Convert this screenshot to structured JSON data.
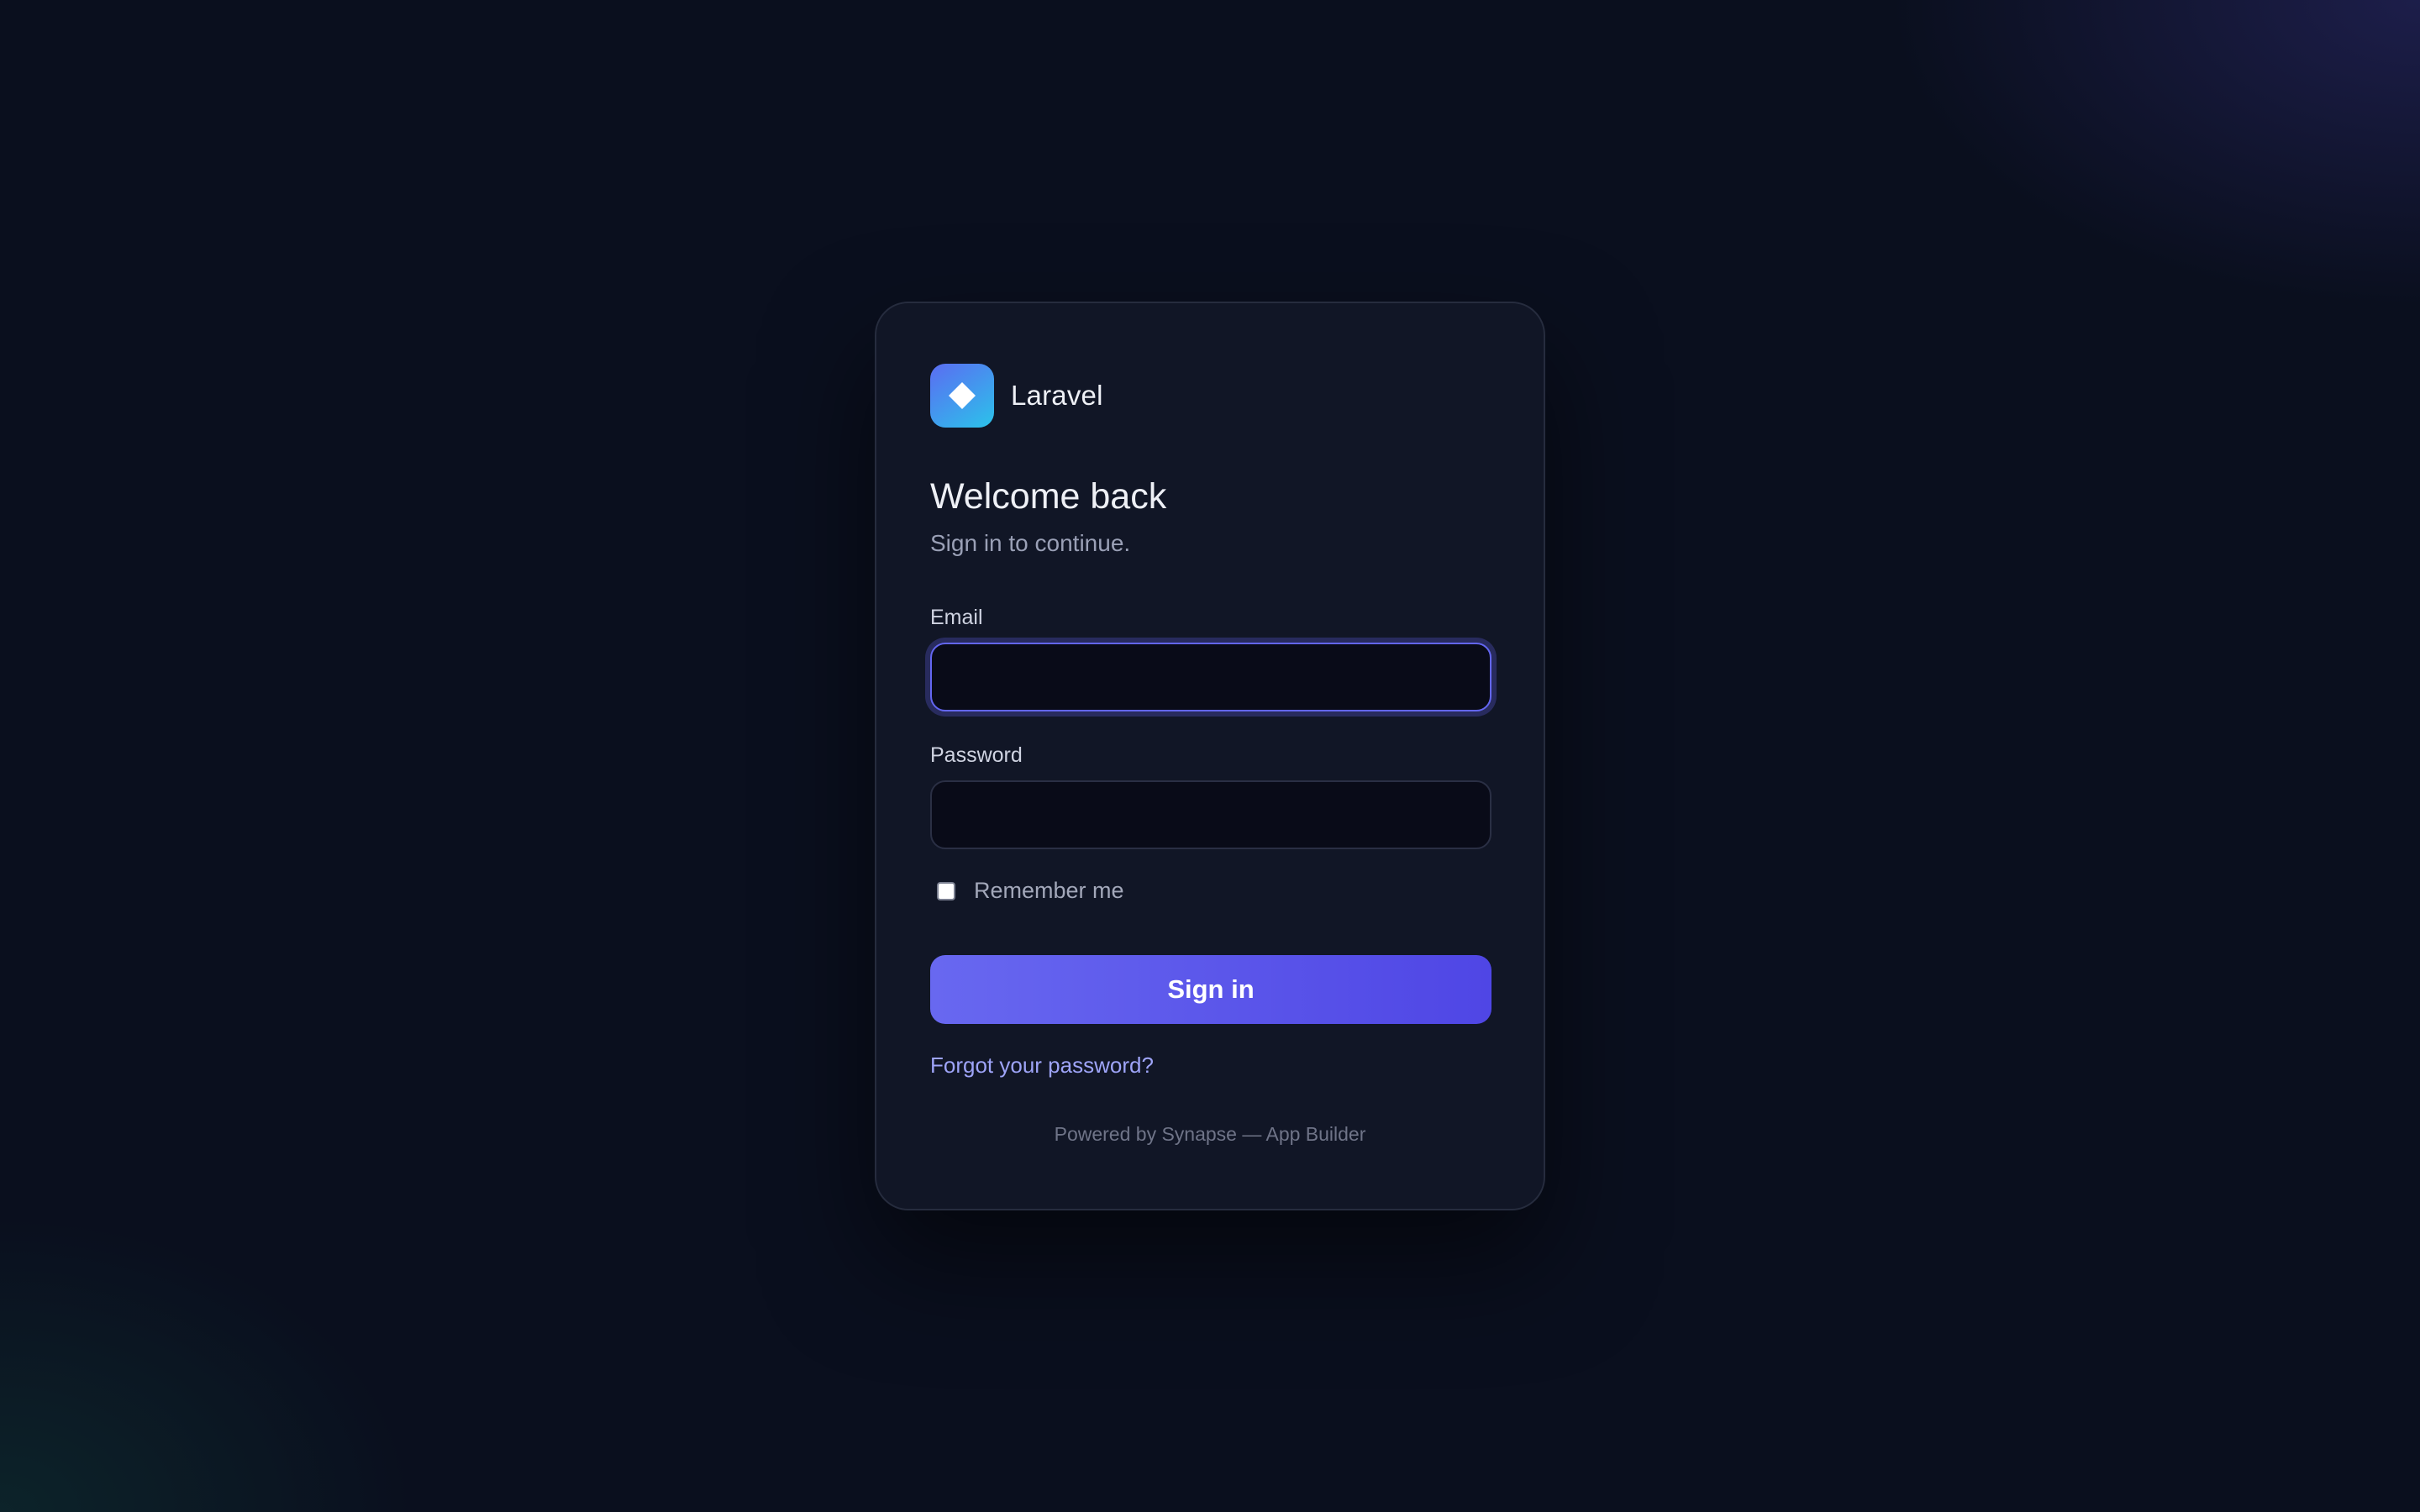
{
  "brand": {
    "name": "Laravel",
    "logo_icon": "diamond-icon",
    "logo_gradient": [
      "#5b6cf2",
      "#2bc3ea"
    ]
  },
  "heading": {
    "title": "Welcome back",
    "subtitle": "Sign in to continue."
  },
  "form": {
    "email": {
      "label": "Email",
      "value": "",
      "placeholder": "",
      "focused": true
    },
    "password": {
      "label": "Password",
      "value": "",
      "placeholder": ""
    },
    "remember": {
      "label": "Remember me",
      "checked": false
    },
    "submit_label": "Sign in",
    "forgot_link": "Forgot your password?"
  },
  "footer": {
    "text": "Powered by Synapse — App Builder"
  },
  "colors": {
    "background": "#0a0f1e",
    "card": "#111626",
    "accent": "#6366f1",
    "link": "#9ea4f8"
  }
}
